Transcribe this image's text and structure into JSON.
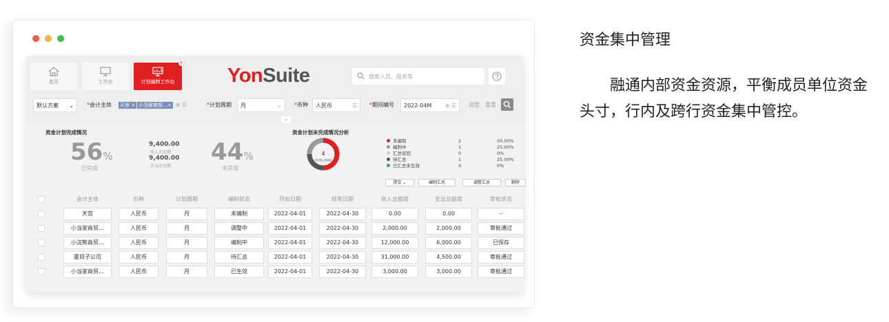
{
  "window": {
    "controls": [
      "close",
      "minimize",
      "maximize"
    ]
  },
  "tabs": [
    {
      "label": "首页",
      "icon": "home-icon"
    },
    {
      "label": "工作台",
      "icon": "monitor-icon"
    },
    {
      "label": "计划编制工作台",
      "icon": "chart-board-icon",
      "active": true
    }
  ],
  "logo": {
    "part1": "Yon",
    "part2": "Suite"
  },
  "search": {
    "placeholder": "搜索人员、服务等"
  },
  "filters": {
    "scheme": "默认方案",
    "entity_label": "会计主体",
    "entity_tag1": "天宫 ×",
    "entity_tag2": "小当家商贸…×",
    "period_label": "计划周期",
    "period_value": "月",
    "currency_label": "币种",
    "currency_value": "人民币",
    "period_no_label": "期间编号",
    "period_no_value": "2022-04M",
    "adjust": "调整",
    "reset": "重置"
  },
  "summary": {
    "complete_title": "资金计划完成情况",
    "complete_pct": "56",
    "complete_caption": "已完成",
    "income_amount": "9,400.00",
    "income_caption": "收入总金额",
    "expense_amount": "9,400.00",
    "expense_caption": "支出总金额",
    "incomplete_pct": "44",
    "incomplete_caption": "未完成",
    "pct_sign": "%",
    "analysis_title": "资金计划未完成情况分析",
    "donut_value": "4",
    "donut_caption": "未完成主体数量"
  },
  "legend": [
    {
      "label": "未编制",
      "count": "2",
      "pct": "50.00%",
      "color": "#e02020"
    },
    {
      "label": "编制中",
      "count": "1",
      "pct": "25.00%",
      "color": "#999999"
    },
    {
      "label": "汇总驳回",
      "count": "0",
      "pct": "0%",
      "color": "#cccccc"
    },
    {
      "label": "待汇总",
      "count": "1",
      "pct": "25.00%",
      "color": "#555555"
    },
    {
      "label": "已汇总未生效",
      "count": "0",
      "pct": "0%",
      "color": "#2fae5a"
    }
  ],
  "actions": {
    "submit": "提交 ⌄",
    "compile_summary": "编制汇总",
    "adjust_summary": "调整汇总",
    "delete": "删除"
  },
  "table": {
    "headers": [
      "会计主体",
      "币种",
      "计划周期",
      "编制状态",
      "开始日期",
      "结束日期",
      "收入总额度",
      "支出总额度",
      "审批状态"
    ],
    "rows": [
      [
        "天宫",
        "人民币",
        "月",
        "未编制",
        "2022-04-01",
        "2022-04-30",
        "0.00",
        "0.00",
        "--"
      ],
      [
        "小当家商贸…",
        "人民币",
        "月",
        "调整中",
        "2022-04-01",
        "2022-04-30",
        "2,000.00",
        "2,000.00",
        "审批通过"
      ],
      [
        "小浣熊商贸…",
        "人民币",
        "月",
        "编制中",
        "2022-04-01",
        "2022-04-30",
        "12,000.00",
        "6,000.00",
        "已保存"
      ],
      [
        "夏目子公司",
        "人民币",
        "月",
        "待汇总",
        "2022-04-01",
        "2022-04-30",
        "31,000.00",
        "4,500.00",
        "审批通过"
      ],
      [
        "小当家商贸…",
        "人民币",
        "月",
        "已生效",
        "2022-04-01",
        "2022-04-30",
        "3,000.00",
        "3,000.00",
        "审批通过"
      ]
    ]
  },
  "side": {
    "title": "资金集中管理",
    "body": "融通内部资金资源，平衡成员单位资金头寸，行内及跨行资金集中管控。"
  }
}
